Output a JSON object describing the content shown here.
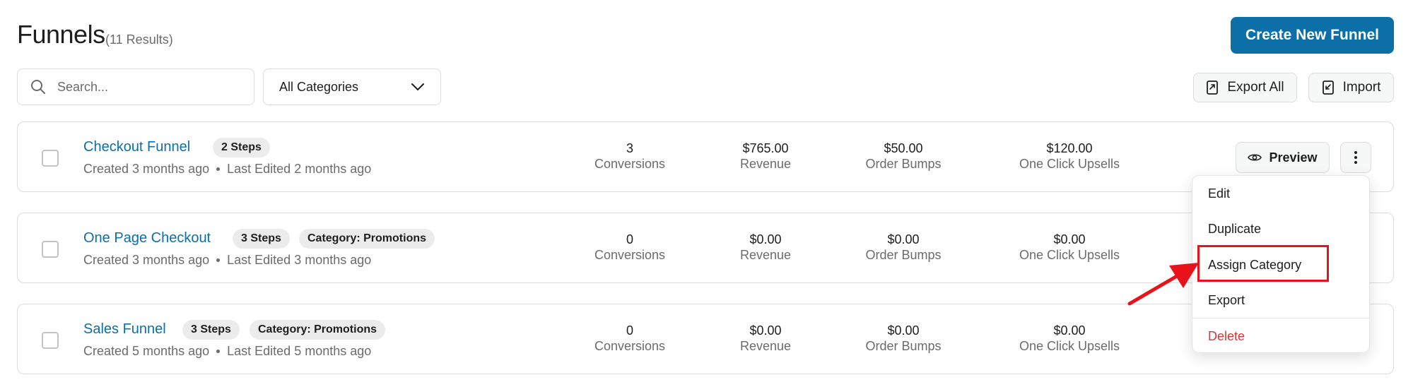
{
  "header": {
    "title": "Funnels",
    "results": "(11 Results)",
    "create_label": "Create New Funnel"
  },
  "filters": {
    "search_placeholder": "Search...",
    "category_selected": "All Categories",
    "export_all_label": "Export All",
    "import_label": "Import"
  },
  "funnels": [
    {
      "name": "Checkout Funnel",
      "steps": "2 Steps",
      "category": "",
      "created": "Created 3 months ago",
      "edited": "Last Edited 2 months ago",
      "conversions": "3",
      "revenue": "$765.00",
      "order_bumps": "$50.00",
      "upsells": "$120.00"
    },
    {
      "name": "One Page Checkout",
      "steps": "3 Steps",
      "category": "Category: Promotions",
      "created": "Created 3 months ago",
      "edited": "Last Edited 3 months ago",
      "conversions": "0",
      "revenue": "$0.00",
      "order_bumps": "$0.00",
      "upsells": "$0.00"
    },
    {
      "name": "Sales Funnel",
      "steps": "3 Steps",
      "category": "Category: Promotions",
      "created": "Created 5 months ago",
      "edited": "Last Edited 5 months ago",
      "conversions": "0",
      "revenue": "$0.00",
      "order_bumps": "$0.00",
      "upsells": "$0.00"
    }
  ],
  "stat_labels": {
    "conversions": "Conversions",
    "revenue": "Revenue",
    "order_bumps": "Order Bumps",
    "upsells": "One Click Upsells"
  },
  "row_actions": {
    "preview_label": "Preview"
  },
  "menu": {
    "edit": "Edit",
    "duplicate": "Duplicate",
    "assign_category": "Assign Category",
    "export": "Export",
    "delete": "Delete"
  },
  "colors": {
    "accent": "#0c6fa8",
    "danger": "#d63638",
    "annotation": "#e8121a"
  },
  "icons": {
    "search": "search-icon",
    "dropdown": "chevron-down-icon",
    "export": "file-export-icon",
    "import": "file-import-icon",
    "preview": "eye-icon",
    "more": "vertical-dots-icon"
  }
}
